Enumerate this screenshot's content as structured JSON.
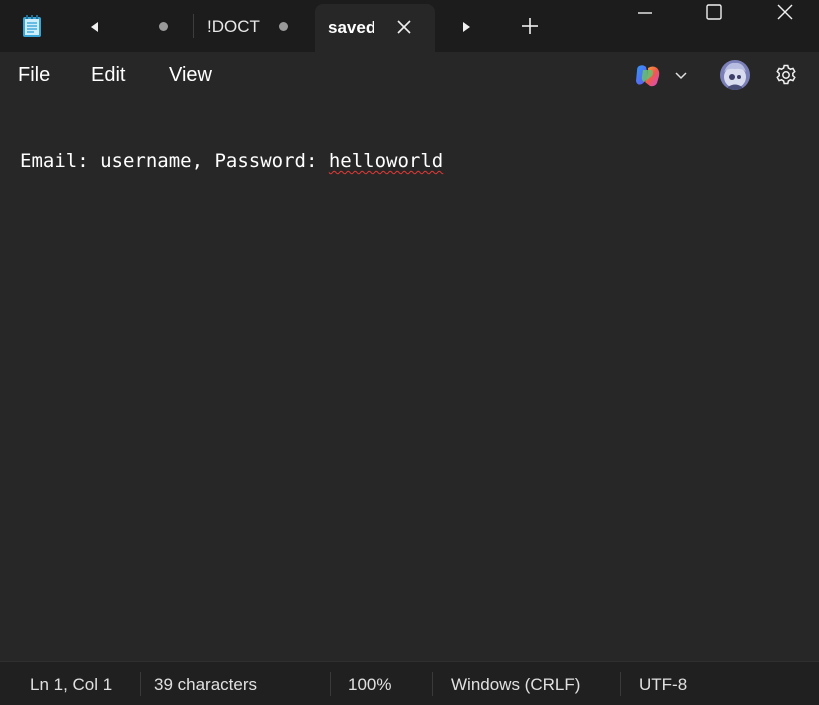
{
  "tabs": [
    {
      "label": "!DOCT",
      "modified": true
    },
    {
      "label": "saved",
      "active": true
    }
  ],
  "menu": {
    "file": "File",
    "edit": "Edit",
    "view": "View"
  },
  "editor": {
    "line_before": "Email: username, Password: ",
    "misspelled_word": "helloworld"
  },
  "status": {
    "position": "Ln 1, Col 1",
    "characters": "39 characters",
    "zoom": "100%",
    "line_ending": "Windows (CRLF)",
    "encoding": "UTF-8"
  },
  "icons": {
    "app": "notepad-icon",
    "scroll_left": "triangle-left-icon",
    "scroll_right": "triangle-right-icon",
    "close_tab": "close-icon",
    "new_tab": "plus-icon",
    "minimize": "minimize-icon",
    "maximize": "maximize-icon",
    "close_window": "close-icon",
    "copilot": "copilot-icon",
    "account": "avatar",
    "settings": "gear-icon"
  },
  "colors": {
    "background": "#272727",
    "titlebar": "#1c1c1c",
    "statusbar": "#202020",
    "spellcheck_underline": "#e53935"
  }
}
